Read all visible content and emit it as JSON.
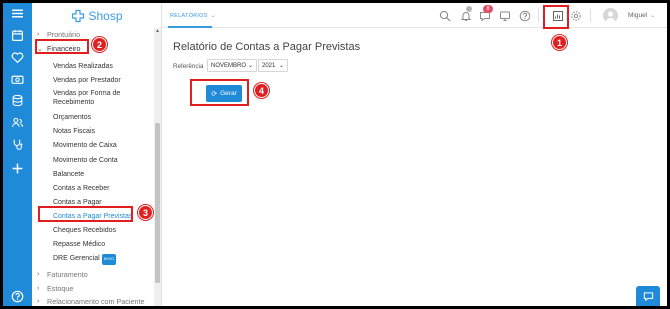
{
  "app": {
    "logo_text": "Shosp"
  },
  "topbar": {
    "tab_label": "RELATÓRIOS",
    "notification_count": "8",
    "user_name": "Miguel"
  },
  "sidebar": {
    "items": [
      {
        "label": "Prontuário"
      },
      {
        "label": "Financeiro"
      }
    ],
    "financeiro_items": [
      "Vendas Realizadas",
      "Vendas por Prestador",
      "Vendas por Forma de",
      "Recebimento",
      "Orçamentos",
      "Notas Fiscais",
      "Movimento de Caixa",
      "Movimento de Conta",
      "Balancete",
      "Contas a Receber",
      "Contas a Pagar",
      "Contas a Pagar Previstas",
      "Cheques Recebidos",
      "Repasse Médico",
      "DRE Gerencial"
    ],
    "new_badge": "NOVO",
    "bottom_items": [
      "Faturamento",
      "Estoque",
      "Relacionamento com Paciente"
    ]
  },
  "main": {
    "title": "Relatório de Contas a Pagar Previstas",
    "reference_label": "Referência",
    "month_value": "NOVEMBRO",
    "year_value": "2021",
    "generate_label": "Gerar"
  },
  "annotations": [
    "1",
    "2",
    "3",
    "4"
  ],
  "colors": {
    "accent": "#1f8ad8",
    "callout": "#e02020"
  },
  "icons": [
    "menu-icon",
    "calendar-icon",
    "heart-icon",
    "money-icon",
    "database-icon",
    "users-icon",
    "stethoscope-icon",
    "plus-icon",
    "help-icon",
    "search-icon",
    "bell-icon",
    "chat-icon",
    "monitor-icon",
    "question-icon",
    "report-icon",
    "gear-icon",
    "user-icon"
  ]
}
